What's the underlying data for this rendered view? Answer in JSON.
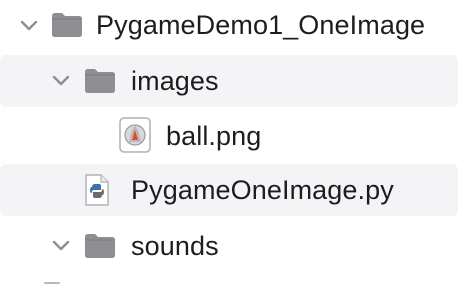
{
  "file_tree": {
    "root": {
      "label": "PygameDemo1_OneImage",
      "icon": "folder-icon",
      "expanded": true,
      "children": [
        {
          "label": "images",
          "icon": "folder-icon",
          "expanded": true,
          "children": [
            {
              "label": "ball.png",
              "icon": "png-image-icon"
            }
          ]
        },
        {
          "label": "PygameOneImage.py",
          "icon": "python-file-icon"
        },
        {
          "label": "sounds",
          "icon": "folder-icon",
          "expanded": true
        }
      ]
    }
  },
  "colors": {
    "folder": "#8e8e93",
    "folder_tab": "#7d7d82",
    "row_stripe": "#f4f4f6",
    "chevron": "#8e8e93",
    "text": "#1d1d1f"
  }
}
